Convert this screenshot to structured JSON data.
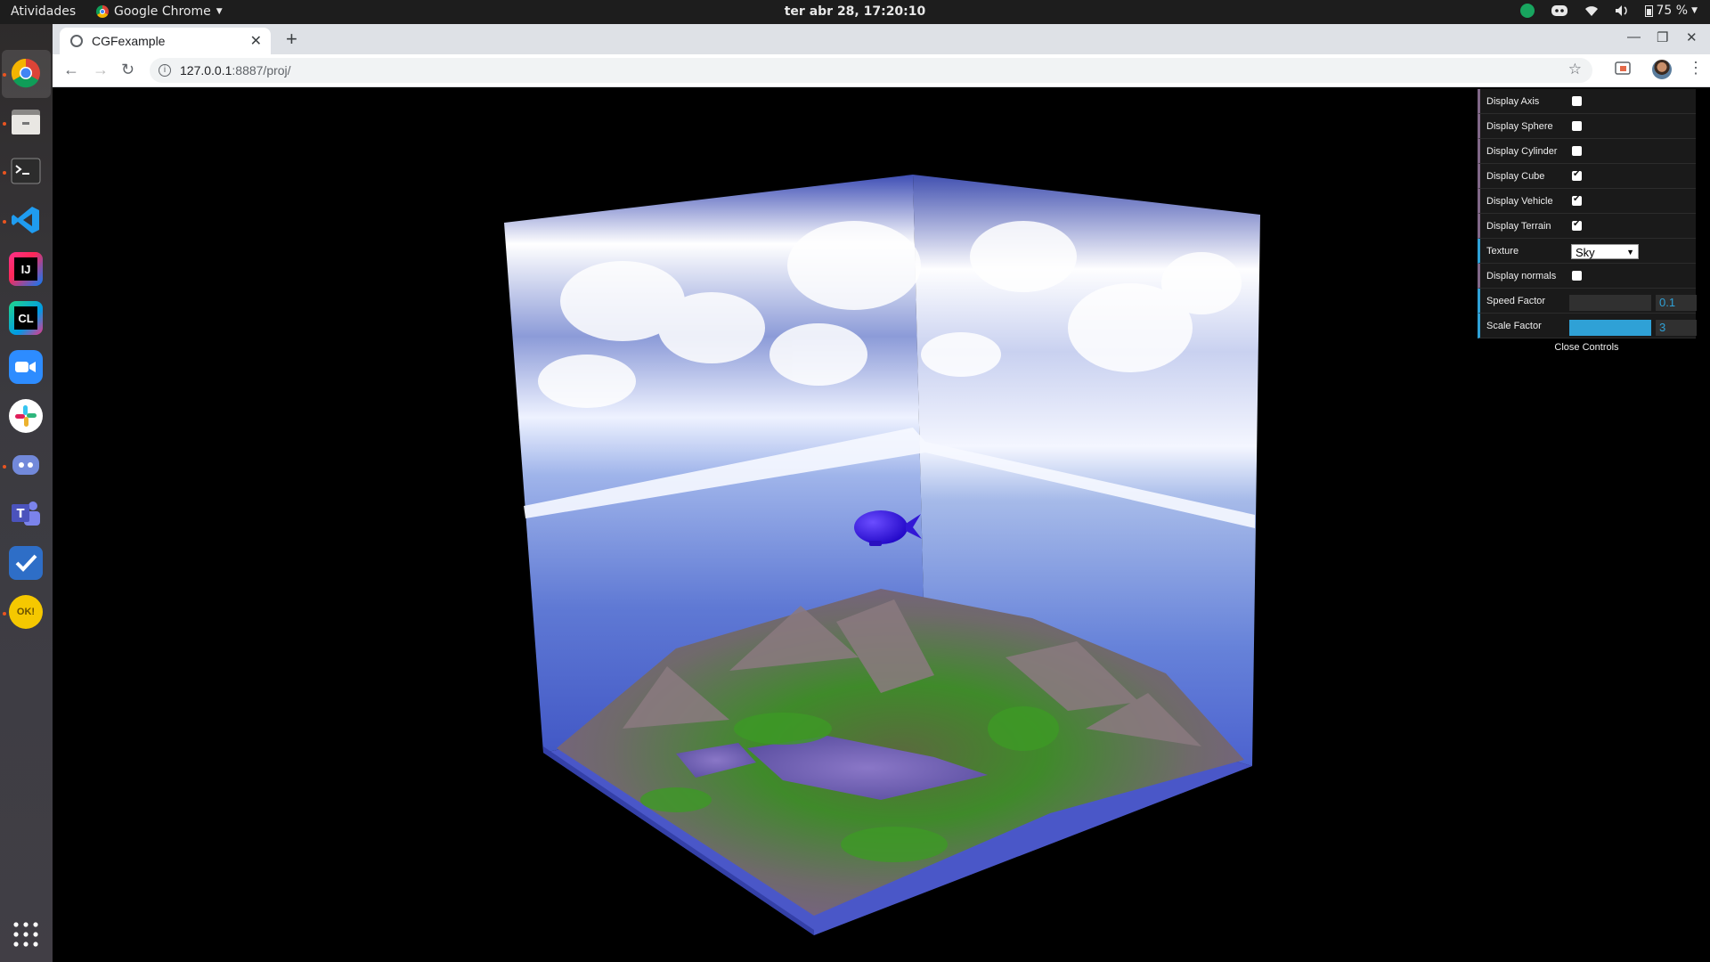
{
  "topbar": {
    "activities": "Atividades",
    "app_name": "Google Chrome",
    "clock": "ter abr 28, 17:20:10",
    "battery": "75 %"
  },
  "dock": {
    "items": [
      {
        "name": "chrome",
        "icon": "chrome-icon"
      },
      {
        "name": "files",
        "icon": "files-icon"
      },
      {
        "name": "terminal",
        "icon": "terminal-icon"
      },
      {
        "name": "vscode",
        "icon": "vscode-icon"
      },
      {
        "name": "intellij",
        "icon": "intellij-icon",
        "text": "IJ"
      },
      {
        "name": "clion",
        "icon": "clion-icon",
        "text": "CL"
      },
      {
        "name": "zoom",
        "icon": "zoom-icon"
      },
      {
        "name": "slack",
        "icon": "slack-icon"
      },
      {
        "name": "discord",
        "icon": "discord-icon"
      },
      {
        "name": "teams",
        "icon": "teams-icon",
        "text": "T"
      },
      {
        "name": "todo",
        "icon": "todo-icon"
      },
      {
        "name": "todook",
        "icon": "todook-icon",
        "text": "OK!"
      }
    ]
  },
  "browser": {
    "tab_title": "CGFexample",
    "url_host": "127.0.0.1",
    "url_path": ":8887/proj/"
  },
  "gui": {
    "rows": [
      {
        "label": "Display Axis",
        "checked": false
      },
      {
        "label": "Display Sphere",
        "checked": false
      },
      {
        "label": "Display Cylinder",
        "checked": false
      },
      {
        "label": "Display Cube",
        "checked": true
      },
      {
        "label": "Display Vehicle",
        "checked": true
      },
      {
        "label": "Display Terrain",
        "checked": true
      }
    ],
    "texture_label": "Texture",
    "texture_value": "Sky",
    "normals_label": "Display normals",
    "speed_label": "Speed Factor",
    "speed_value": "0.1",
    "speed_fraction": 0.0,
    "scale_label": "Scale Factor",
    "scale_value": "3",
    "scale_fraction": 1.0,
    "close_label": "Close Controls"
  },
  "colors": {
    "accent": "#2fa1d6",
    "bool_border": "#806787"
  }
}
